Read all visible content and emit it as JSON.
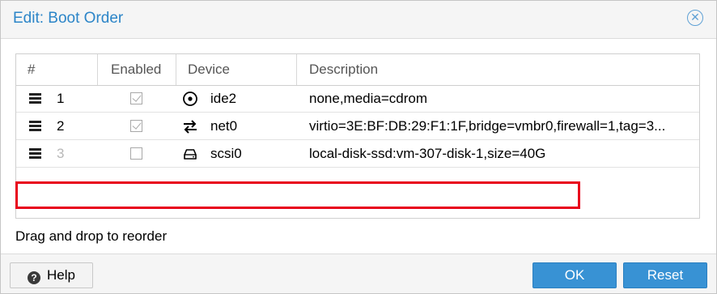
{
  "dialog": {
    "title": "Edit: Boot Order",
    "close_icon": "close-circle-icon"
  },
  "grid": {
    "columns": [
      "#",
      "Enabled",
      "Device",
      "Description"
    ],
    "rows": [
      {
        "num": "1",
        "enabled": true,
        "icon": "cdrom-icon",
        "device": "ide2",
        "description": "none,media=cdrom"
      },
      {
        "num": "2",
        "enabled": true,
        "icon": "network-icon",
        "device": "net0",
        "description": "virtio=3E:BF:DB:29:F1:1F,bridge=vmbr0,firewall=1,tag=3..."
      },
      {
        "num": "3",
        "enabled": false,
        "icon": "hard-disk-icon",
        "device": "scsi0",
        "description": "local-disk-ssd:vm-307-disk-1,size=40G"
      }
    ]
  },
  "hint": "Drag and drop to reorder",
  "buttons": {
    "help": "Help",
    "ok": "OK",
    "reset": "Reset"
  },
  "colors": {
    "accent": "#3892d4",
    "title": "#2c85c8",
    "highlight": "#e8001c"
  }
}
